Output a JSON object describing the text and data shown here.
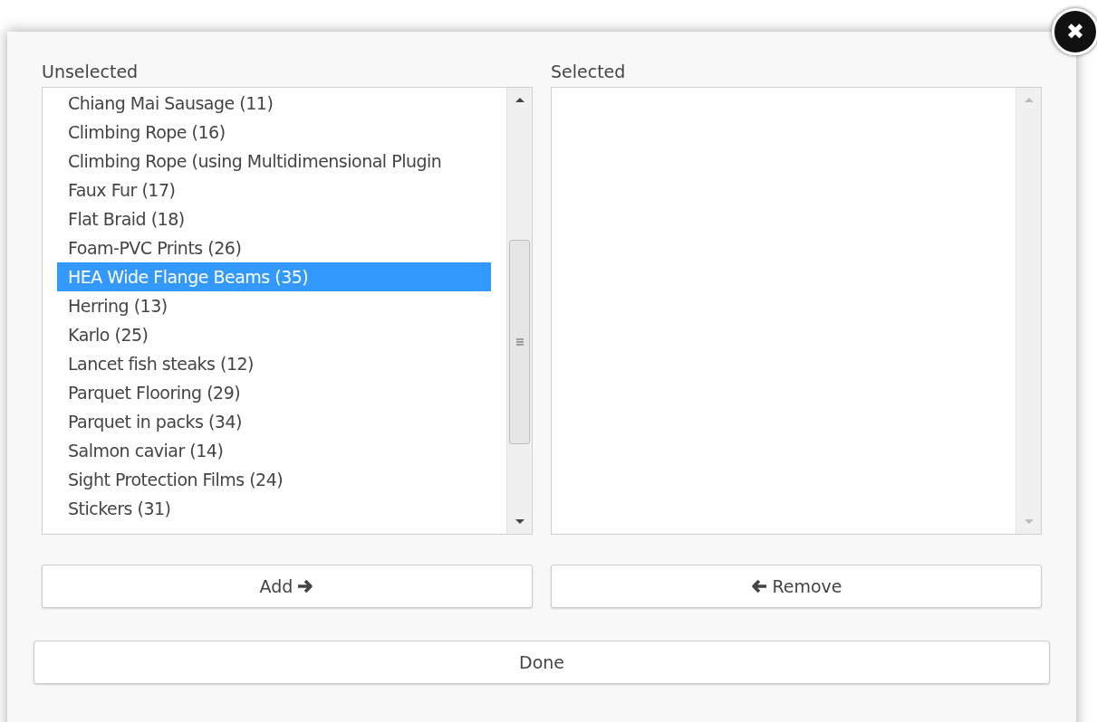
{
  "dialog": {
    "close_button": "✖",
    "unselected": {
      "label": "Unselected",
      "items": [
        {
          "text": "Chiang Mai Sausage (11)",
          "selected": false
        },
        {
          "text": "Climbing Rope (16)",
          "selected": false
        },
        {
          "text": "Climbing Rope (using Multidimensional Plugin",
          "selected": false
        },
        {
          "text": "Faux Fur (17)",
          "selected": false
        },
        {
          "text": "Flat Braid (18)",
          "selected": false
        },
        {
          "text": "Foam-PVC Prints (26)",
          "selected": false
        },
        {
          "text": "HEA Wide Flange Beams (35)",
          "selected": true
        },
        {
          "text": "Herring (13)",
          "selected": false
        },
        {
          "text": "Karlo (25)",
          "selected": false
        },
        {
          "text": "Lancet fish steaks (12)",
          "selected": false
        },
        {
          "text": "Parquet Flooring (29)",
          "selected": false
        },
        {
          "text": "Parquet in packs (34)",
          "selected": false
        },
        {
          "text": "Salmon caviar (14)",
          "selected": false
        },
        {
          "text": "Sight Protection Films (24)",
          "selected": false
        },
        {
          "text": "Stickers (31)",
          "selected": false
        }
      ]
    },
    "selected": {
      "label": "Selected"
    },
    "add_button": "Add",
    "remove_button": "Remove",
    "done_button": "Done"
  }
}
